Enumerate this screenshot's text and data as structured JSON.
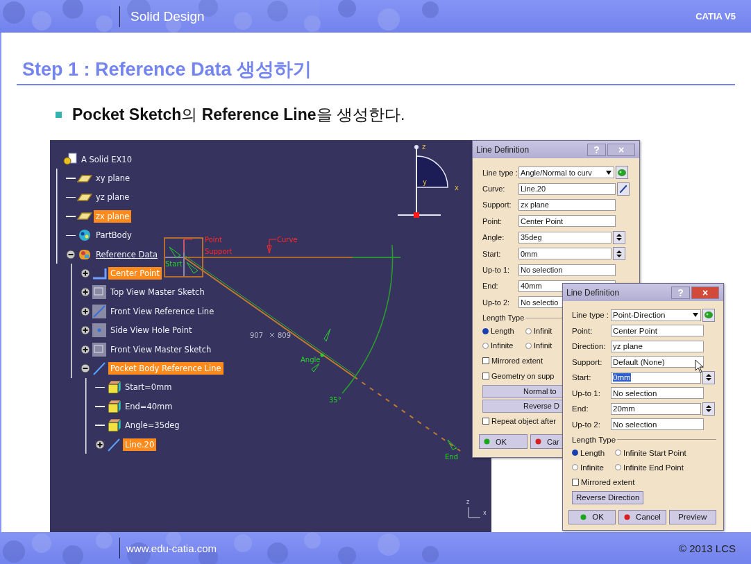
{
  "header": {
    "section": "Solid Design",
    "product": "CATIA V5"
  },
  "title": "Step 1 : Reference Data 생성하기",
  "bullet": "**Pocket Sketch**의 **Reference Line**을 생성한다.",
  "tree": {
    "label": "A Solid EX10",
    "kind": "part",
    "selected": false,
    "in_work": false,
    "children": [
      {
        "label": "xy plane",
        "kind": "plane",
        "selected": false,
        "in_work": false
      },
      {
        "label": "yz plane",
        "kind": "plane",
        "selected": false,
        "in_work": false
      },
      {
        "label": "zx plane",
        "kind": "plane",
        "selected": true,
        "in_work": false
      },
      {
        "label": "PartBody",
        "kind": "body",
        "selected": false,
        "in_work": false
      },
      {
        "label": "Reference Data",
        "kind": "geoset",
        "selected": false,
        "in_work": true,
        "expanded": true,
        "children": [
          {
            "label": "Center Point",
            "kind": "point",
            "selected": true,
            "in_work": false,
            "expanded": false
          },
          {
            "label": "Top View Master Sketch",
            "kind": "sketch",
            "selected": false,
            "in_work": false,
            "expanded": false
          },
          {
            "label": "Front View Reference Line",
            "kind": "sketch-line",
            "selected": false,
            "in_work": false,
            "expanded": false
          },
          {
            "label": "Side View Hole Point",
            "kind": "sketch-point",
            "selected": false,
            "in_work": false,
            "expanded": false
          },
          {
            "label": "Front View Master Sketch",
            "kind": "sketch",
            "selected": false,
            "in_work": false,
            "expanded": false
          },
          {
            "label": "Pocket Body Reference Line",
            "kind": "line",
            "selected": true,
            "in_work": false,
            "expanded": true,
            "children": [
              {
                "label": "Start=0mm",
                "kind": "param",
                "selected": false,
                "in_work": false
              },
              {
                "label": "End=40mm",
                "kind": "param",
                "selected": false,
                "in_work": false
              },
              {
                "label": "Angle=35deg",
                "kind": "param",
                "selected": false,
                "in_work": false
              },
              {
                "label": "Line.20",
                "kind": "line",
                "selected": true,
                "in_work": false,
                "expanded": false
              }
            ]
          }
        ]
      }
    ]
  },
  "canvas": {
    "labels": [
      {
        "text": "Point",
        "kind": "handle"
      },
      {
        "text": "Support",
        "kind": "handle"
      },
      {
        "text": "Curve",
        "kind": "handle"
      },
      {
        "text": "Start",
        "kind": "manip"
      },
      {
        "text": "907",
        "kind": "coord"
      },
      {
        "text": "809",
        "kind": "coord"
      },
      {
        "text": "Angle",
        "kind": "manip"
      },
      {
        "text": "35°",
        "kind": "manip"
      },
      {
        "text": "End",
        "kind": "manip"
      }
    ],
    "compass": [
      "z",
      "y",
      "x"
    ],
    "axis": [
      "z",
      "x"
    ]
  },
  "dialogs": [
    {
      "title": "Line Definition",
      "active": false,
      "title_buttons": [
        "?",
        "×"
      ],
      "fields": [
        {
          "label": "Line type :",
          "value": "Angle/Normal to curv",
          "kind": "combo"
        },
        {
          "label": "Curve:",
          "value": "Line.20",
          "kind": "pick"
        },
        {
          "label": "Support:",
          "value": "zx plane",
          "kind": "text"
        },
        {
          "label": "Point:",
          "value": "Center Point",
          "kind": "text"
        },
        {
          "label": "Angle:",
          "value": "35deg",
          "kind": "spin"
        },
        {
          "label": "Start:",
          "value": "0mm",
          "kind": "spin"
        },
        {
          "label": "Up-to 1:",
          "value": "No selection",
          "kind": "text"
        },
        {
          "label": "End:",
          "value": "40mm",
          "kind": "text"
        },
        {
          "label": "Up-to 2:",
          "value": "No selectio",
          "kind": "text"
        }
      ],
      "group": "Length Type",
      "options": [
        {
          "label": "Length",
          "selected": true
        },
        {
          "label": "Infinit",
          "selected": false
        },
        {
          "label": "Infinite",
          "selected": false
        },
        {
          "label": "Infinit",
          "selected": false
        }
      ],
      "controls": [
        {
          "kind": "check",
          "label": "Mirrored extent",
          "checked": false
        },
        {
          "kind": "check",
          "label": "Geometry on supp",
          "checked": false
        },
        {
          "kind": "wide",
          "label": "Normal to"
        },
        {
          "kind": "wide",
          "label": "Reverse D"
        },
        {
          "kind": "check",
          "label": "Repeat object after",
          "checked": false
        }
      ],
      "buttons": [
        {
          "label": "OK",
          "kind": "ok"
        },
        {
          "label": "Car",
          "kind": "cancel"
        }
      ]
    },
    {
      "title": "Line Definition",
      "active": true,
      "title_buttons": [
        "?",
        "×"
      ],
      "fields": [
        {
          "label": "Line type :",
          "value": "Point-Direction",
          "kind": "combo"
        },
        {
          "label": "Point:",
          "value": "Center Point",
          "kind": "text"
        },
        {
          "label": "Direction:",
          "value": "yz plane",
          "kind": "text"
        },
        {
          "label": "Support:",
          "value": "Default (None)",
          "kind": "text"
        },
        {
          "label": "Start:",
          "value": "0mm",
          "kind": "spin",
          "text_selected": true
        },
        {
          "label": "Up-to 1:",
          "value": "No selection",
          "kind": "text"
        },
        {
          "label": "End:",
          "value": "20mm",
          "kind": "spin"
        },
        {
          "label": "Up-to 2:",
          "value": "No selection",
          "kind": "text"
        }
      ],
      "group": "Length Type",
      "options": [
        {
          "label": "Length",
          "selected": true
        },
        {
          "label": "Infinite Start Point",
          "selected": false
        },
        {
          "label": "Infinite",
          "selected": false
        },
        {
          "label": "Infinite End Point",
          "selected": false
        }
      ],
      "controls": [
        {
          "kind": "check",
          "label": "Mirrored extent",
          "checked": false
        },
        {
          "kind": "button",
          "label": "Reverse Direction"
        }
      ],
      "buttons": [
        {
          "label": "OK",
          "kind": "ok"
        },
        {
          "label": "Cancel",
          "kind": "cancel"
        },
        {
          "label": "Preview",
          "kind": "plain"
        }
      ]
    }
  ],
  "footer": {
    "url": "www.edu-catia.com",
    "copyright": "© 2013 LCS"
  }
}
